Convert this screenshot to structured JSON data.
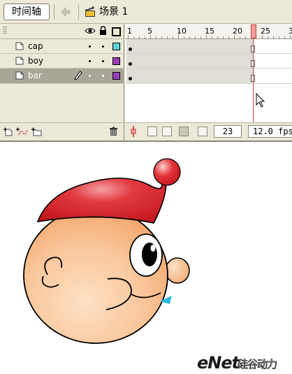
{
  "toolbar": {
    "timeline_label": "时间轴",
    "scene_label": "场景 1"
  },
  "timeline": {
    "ruler_numbers": [
      "1",
      "5",
      "10",
      "15",
      "20",
      "25",
      "3"
    ],
    "layers": [
      {
        "name": "cap",
        "color": "#5fd3d8",
        "selected": false
      },
      {
        "name": "boy",
        "color": "#9a3db8",
        "selected": false
      },
      {
        "name": "bar",
        "color": "#9a3db8",
        "selected": true
      }
    ],
    "current_frame": "23",
    "frame_rate": "12.0 fps"
  },
  "stage": {
    "watermark_latin": "eNet",
    "watermark_cn": "硅谷动力"
  },
  "colors": {
    "panel_bg": "#ece9d8",
    "selected_row": "#a9a697",
    "playhead": "#f3a0a0",
    "cap_red": "#d8202a",
    "skin": "#f9c69a",
    "bowtie": "#2bb8e6"
  },
  "icons": {
    "back": "back-arrow-icon",
    "scene": "scene-clapper-icon",
    "eye": "eye-icon",
    "lock": "lock-icon",
    "outline": "outline-square-icon",
    "pencil": "pencil-icon",
    "trash": "trash-icon"
  }
}
